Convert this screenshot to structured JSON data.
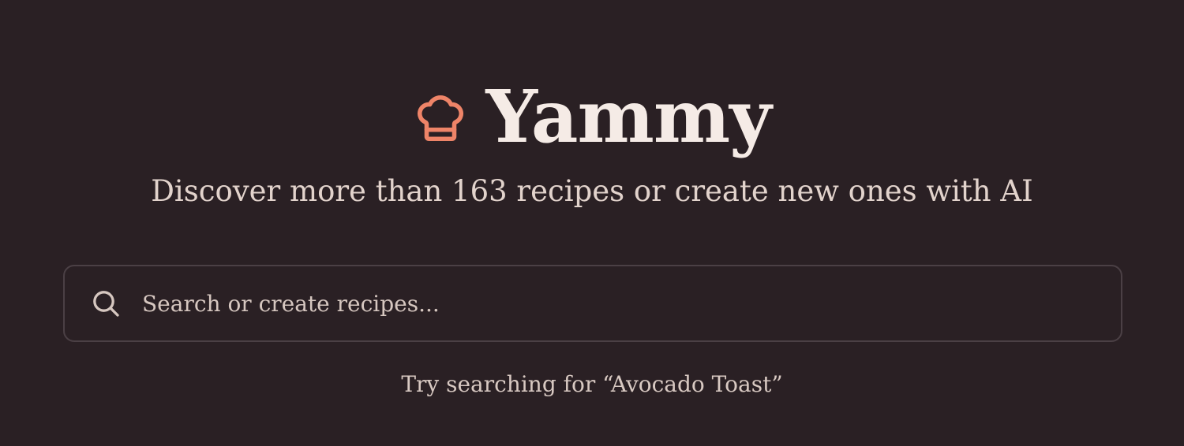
{
  "brand": {
    "name": "Yammy",
    "icon": "chef-hat-icon",
    "icon_color": "#ee8468"
  },
  "hero": {
    "tagline": "Discover more than 163 recipes or create new ones with AI"
  },
  "search": {
    "icon": "search-icon",
    "placeholder": "Search or create recipes...",
    "value": ""
  },
  "hint": {
    "text": "Try searching for “Avocado Toast”"
  },
  "theme": {
    "background": "#2a2024",
    "text_primary": "#f5ebe6",
    "text_secondary": "#e2d3cc",
    "border": "#4b4045",
    "accent": "#ee8468"
  }
}
